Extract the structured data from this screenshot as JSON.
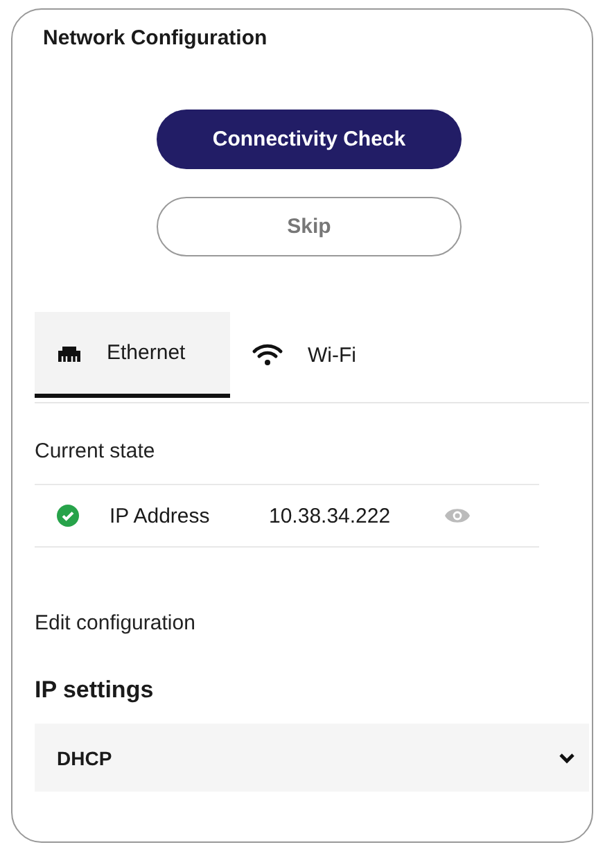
{
  "title": "Network Configuration",
  "buttons": [
    {
      "label": "Connectivity Check",
      "kind": "primary"
    },
    {
      "label": "Skip",
      "kind": "secondary"
    }
  ],
  "tabs": [
    {
      "label": "Ethernet",
      "kind": "ethernet",
      "selected": true
    },
    {
      "label": "Wi-Fi",
      "kind": "wifi",
      "selected": false
    }
  ],
  "current_state": {
    "heading": "Current state",
    "rows": [
      {
        "label": "IP Address",
        "value": "10.38.34.222"
      }
    ]
  },
  "edit": {
    "heading": "Edit configuration",
    "section": "IP settings",
    "select": {
      "value": "DHCP"
    }
  }
}
